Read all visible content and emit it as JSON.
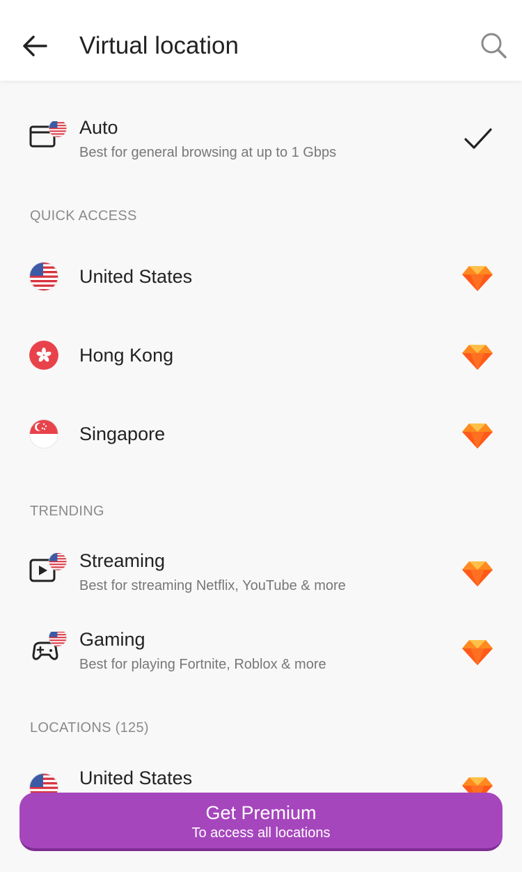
{
  "header": {
    "title": "Virtual location",
    "back_icon": "arrow-left-icon",
    "search_icon": "search-icon"
  },
  "auto": {
    "title": "Auto",
    "subtitle": "Best for general browsing at up to 1 Gbps",
    "selected": true
  },
  "sections": {
    "quick_access": "QUICK ACCESS",
    "trending": "TRENDING",
    "locations": "LOCATIONS (125)"
  },
  "quick_access": [
    {
      "name": "United States",
      "flag": "us-flag-icon"
    },
    {
      "name": "Hong Kong",
      "flag": "hk-flag-icon"
    },
    {
      "name": "Singapore",
      "flag": "sg-flag-icon"
    }
  ],
  "trending": [
    {
      "title": "Streaming",
      "subtitle": "Best for streaming Netflix, YouTube & more",
      "icon": "streaming-icon"
    },
    {
      "title": "Gaming",
      "subtitle": "Best for playing Fortnite, Roblox & more",
      "icon": "gamepad-icon"
    }
  ],
  "locations": [
    {
      "name": "United States",
      "flag": "us-flag-icon"
    }
  ],
  "premium": {
    "title": "Get Premium",
    "subtitle": "To access all locations"
  },
  "colors": {
    "accent": "#a646bd",
    "premium_gem": "#ff7a1a",
    "background": "#f8f8f8"
  }
}
